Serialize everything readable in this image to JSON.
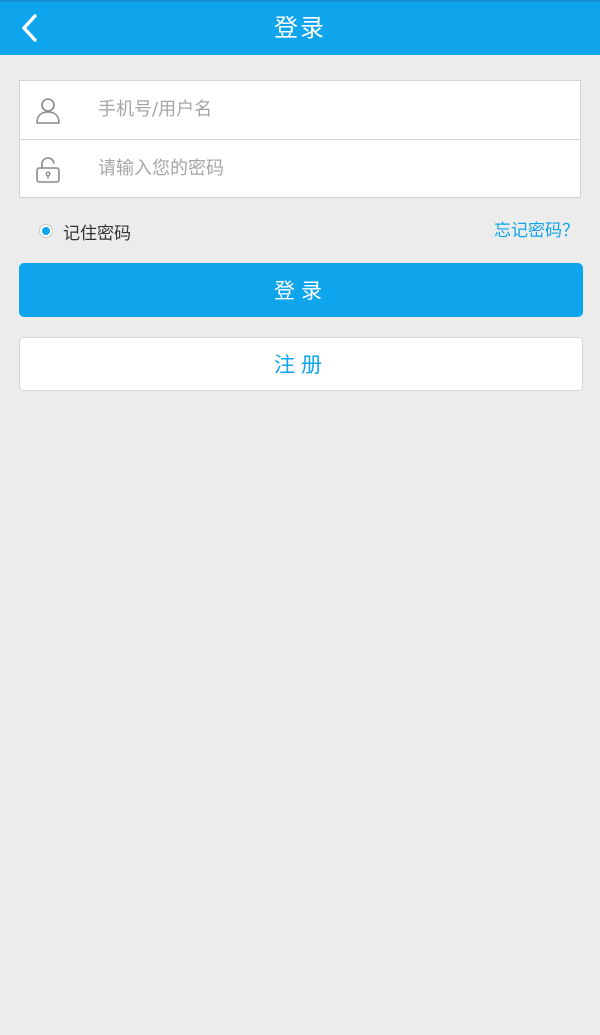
{
  "header": {
    "title": "登录",
    "back_icon": "chevron-left-icon"
  },
  "form": {
    "username": {
      "icon": "user-icon",
      "placeholder": "手机号/用户名",
      "value": ""
    },
    "password": {
      "icon": "lock-icon",
      "placeholder": "请输入您的密码",
      "value": ""
    }
  },
  "options": {
    "remember_label": "记住密码",
    "remember_checked": true,
    "forgot_label": "忘记密码？"
  },
  "actions": {
    "login_label": "登录",
    "register_label": "注册"
  },
  "colors": {
    "accent": "#0ea5ec",
    "background": "#ececec"
  }
}
